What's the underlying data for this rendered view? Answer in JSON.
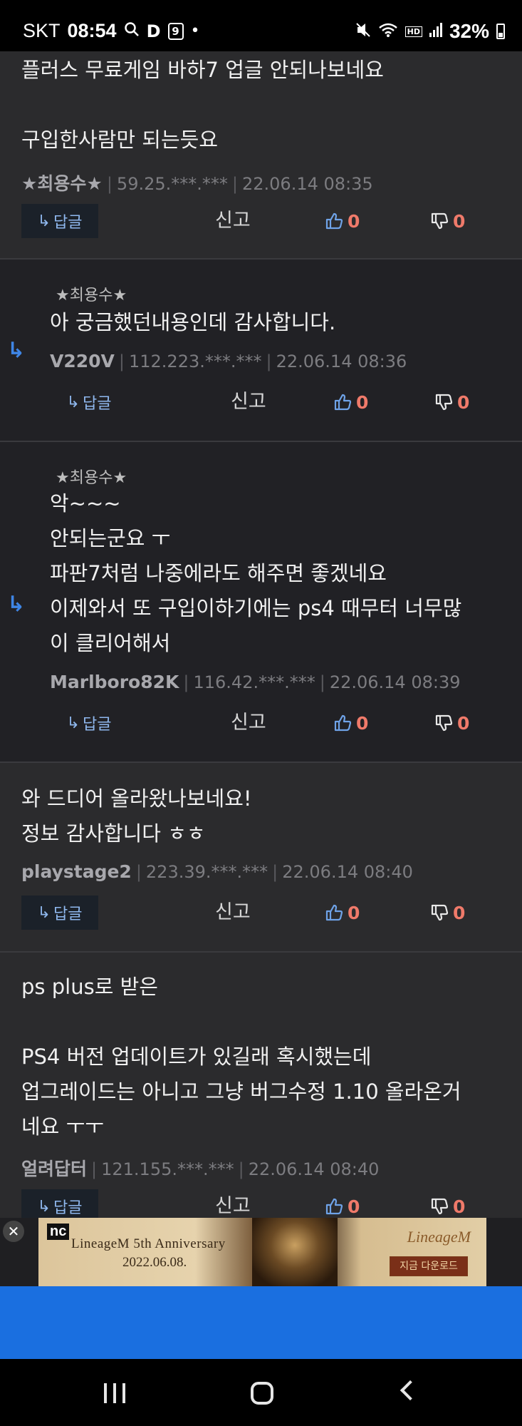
{
  "status_bar": {
    "carrier": "SKT",
    "time": "08:54",
    "d_badge": "D",
    "nine_badge": "9",
    "dot": "•",
    "battery": "32%",
    "hd_voice": "HD"
  },
  "actions": {
    "reply_label": "답글",
    "report_label": "신고",
    "reply_arrow": "↳",
    "reply_marker": "↳"
  },
  "comments": [
    {
      "text": "플러스 무료게임 바하7 업글 안되나보네요\n\n구입한사람만 되는듯요",
      "nick": "★최용수★",
      "ip": "59.25.***.***",
      "date": "22.06.14 08:35",
      "likes": "0",
      "dislikes": "0"
    },
    {
      "reply_to": "★최용수★",
      "text": "아 궁금했던내용인데 감사합니다.",
      "nick": "V220V",
      "ip": "112.223.***.***",
      "date": "22.06.14 08:36",
      "likes": "0",
      "dislikes": "0"
    },
    {
      "reply_to": "★최용수★",
      "text": "악~~~\n안되는군요 ㅜ\n파판7처럼 나중에라도 해주면 좋겠네요\n이제와서 또 구입이하기에는 ps4 때무터 너무많\n이 클리어해서",
      "nick": "Marlboro82K",
      "ip": "116.42.***.***",
      "date": "22.06.14 08:39",
      "likes": "0",
      "dislikes": "0"
    },
    {
      "text": "와 드디어 올라왔나보네요!\n정보 감사합니다 ㅎㅎ",
      "nick": "playstage2",
      "ip": "223.39.***.***",
      "date": "22.06.14 08:40",
      "likes": "0",
      "dislikes": "0"
    },
    {
      "text": "ps plus로 받은\n\nPS4 버전 업데이트가 있길래 혹시했는데\n업그레이드는 아니고 그냥 버그수정 1.10 올라온거\n네요 ㅜㅜ",
      "nick": "얼려답터",
      "ip": "121.155.***.***",
      "date": "22.06.14 08:40",
      "likes": "0",
      "dislikes": "0"
    }
  ],
  "ad": {
    "close": "✕",
    "brand": "nc",
    "title": "LineageM 5th Anniversary",
    "date": "2022.06.08.",
    "logo": "LineageM",
    "download": "지금 다운로드"
  },
  "colors": {
    "background": "#2b2b2d",
    "reply_background": "#212125",
    "accent_blue": "#3f86e6",
    "vote_red": "#ef7a6a",
    "bottom_bar": "#1a6fe0"
  }
}
